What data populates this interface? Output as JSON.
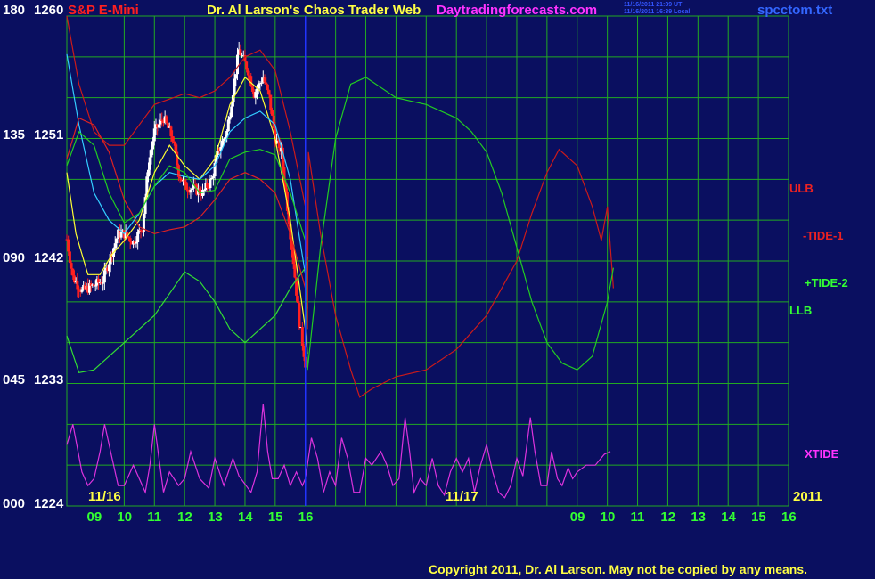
{
  "header": {
    "symbol": "S&P E-Mini",
    "title": "Dr. Al Larson's Chaos Trader Web",
    "site": "Daytradingforecasts.com",
    "time_ut": "11/16/2011 21:39 UT",
    "time_local": "11/16/2011 16:39 Local",
    "file": "spcctom.txt"
  },
  "copyright": "Copyright 2011, Dr. Al Larson. May not be copied by any means.",
  "colors": {
    "background": "#0a0f60",
    "grid": "#22aa22",
    "price_up": "#ffffff",
    "price_down": "#ff2020",
    "ulb": "#cc1a1a",
    "tide1": "#dd2222",
    "tide2": "#22cc22",
    "llb": "#33dd33",
    "xtide": "#dd33dd",
    "ma_fast": "#ffff33",
    "ma_slow": "#33ccff",
    "now_line": "#2233ff"
  },
  "chart_data": {
    "type": "line",
    "title": "Dr. Al Larson's Chaos Trader Web",
    "y_left_labels": [
      "180",
      "135",
      "090",
      "045",
      "000"
    ],
    "y_price_labels": [
      "1260",
      "1251",
      "1242",
      "1233",
      "1224"
    ],
    "ylim_price": [
      1224,
      1260
    ],
    "ylim_cycle": [
      0,
      180
    ],
    "x_ticks": [
      "09",
      "10",
      "11",
      "12",
      "13",
      "14",
      "15",
      "16",
      "09",
      "10",
      "11",
      "12",
      "13",
      "14",
      "15",
      "16"
    ],
    "date_labels": [
      "11/16",
      "11/17",
      "2011"
    ],
    "x_unit": "hour",
    "xlim_hours": [
      8.1,
      32.0
    ],
    "now_hour": 16.0,
    "grid": true,
    "series_labels": [
      "ULB",
      "-TIDE-1",
      "+TIDE-2",
      "LLB",
      "XTIDE"
    ],
    "price_knots": [
      [
        8.1,
        1243.6
      ],
      [
        8.3,
        1240.8
      ],
      [
        8.6,
        1239.8
      ],
      [
        9.0,
        1240.2
      ],
      [
        9.3,
        1240.6
      ],
      [
        9.5,
        1242.0
      ],
      [
        9.8,
        1244.0
      ],
      [
        10.0,
        1244.0
      ],
      [
        10.3,
        1243.4
      ],
      [
        10.6,
        1244.5
      ],
      [
        10.8,
        1249.0
      ],
      [
        11.0,
        1251.5
      ],
      [
        11.3,
        1252.5
      ],
      [
        11.6,
        1251.0
      ],
      [
        11.8,
        1248.5
      ],
      [
        12.0,
        1247.5
      ],
      [
        12.3,
        1247.3
      ],
      [
        12.6,
        1247.0
      ],
      [
        12.9,
        1248.0
      ],
      [
        13.1,
        1250.0
      ],
      [
        13.4,
        1251.5
      ],
      [
        13.6,
        1254.5
      ],
      [
        13.8,
        1257.5
      ],
      [
        14.1,
        1256.0
      ],
      [
        14.3,
        1254.3
      ],
      [
        14.6,
        1255.5
      ],
      [
        14.8,
        1254.0
      ],
      [
        15.0,
        1251.0
      ],
      [
        15.2,
        1250.0
      ],
      [
        15.4,
        1246.0
      ],
      [
        15.6,
        1242.0
      ],
      [
        15.8,
        1237.5
      ],
      [
        16.0,
        1234.5
      ],
      [
        16.05,
        1233.0
      ]
    ],
    "series": [
      {
        "id": "ma_fast",
        "knots": [
          [
            8.1,
            1248.5
          ],
          [
            8.4,
            1244.0
          ],
          [
            8.8,
            1241.0
          ],
          [
            9.2,
            1241.0
          ],
          [
            9.6,
            1242.5
          ],
          [
            10.0,
            1243.5
          ],
          [
            10.5,
            1245.0
          ],
          [
            11.0,
            1248.5
          ],
          [
            11.5,
            1250.5
          ],
          [
            12.0,
            1249.0
          ],
          [
            12.5,
            1248.0
          ],
          [
            13.0,
            1249.5
          ],
          [
            13.5,
            1253.5
          ],
          [
            14.0,
            1255.5
          ],
          [
            14.5,
            1254.5
          ],
          [
            15.0,
            1251.0
          ],
          [
            15.5,
            1245.0
          ],
          [
            16.0,
            1237.0
          ],
          [
            16.07,
            1235.2
          ]
        ]
      },
      {
        "id": "ma_slow",
        "knots": [
          [
            8.1,
            1257.2
          ],
          [
            8.5,
            1252.0
          ],
          [
            9.0,
            1247.0
          ],
          [
            9.5,
            1245.0
          ],
          [
            10.0,
            1244.0
          ],
          [
            10.5,
            1245.5
          ],
          [
            11.0,
            1247.5
          ],
          [
            11.5,
            1248.5
          ],
          [
            12.0,
            1248.2
          ],
          [
            12.5,
            1248.0
          ],
          [
            13.0,
            1249.0
          ],
          [
            13.5,
            1251.5
          ],
          [
            14.0,
            1252.5
          ],
          [
            14.5,
            1253.0
          ],
          [
            15.0,
            1252.0
          ],
          [
            15.5,
            1248.0
          ],
          [
            16.0,
            1241.0
          ],
          [
            16.07,
            1240.0
          ]
        ]
      },
      {
        "id": "ulb",
        "knots": [
          [
            8.1,
            1260.0
          ],
          [
            8.5,
            1255.0
          ],
          [
            9.0,
            1251.5
          ],
          [
            9.5,
            1250.5
          ],
          [
            10.0,
            1250.5
          ],
          [
            10.5,
            1252.0
          ],
          [
            11.0,
            1253.5
          ],
          [
            12.0,
            1254.3
          ],
          [
            12.5,
            1254.0
          ],
          [
            13.0,
            1254.5
          ],
          [
            13.5,
            1255.5
          ],
          [
            14.0,
            1257.0
          ],
          [
            14.5,
            1257.5
          ],
          [
            15.0,
            1256.0
          ],
          [
            15.5,
            1251.5
          ],
          [
            16.0,
            1246.0
          ],
          [
            16.07,
            1237.0
          ],
          [
            16.1,
            1250.0
          ],
          [
            16.5,
            1244.0
          ],
          [
            17.0,
            1238.0
          ],
          [
            17.5,
            1234.0
          ],
          [
            17.8,
            1232.0
          ],
          [
            18.2,
            1232.6
          ],
          [
            19.0,
            1233.5
          ],
          [
            20.0,
            1234.0
          ],
          [
            21.0,
            1235.5
          ],
          [
            22.0,
            1238.0
          ],
          [
            23.0,
            1242.0
          ],
          [
            23.5,
            1245.5
          ],
          [
            24.0,
            1248.5
          ],
          [
            24.4,
            1250.2
          ],
          [
            25.0,
            1249.0
          ],
          [
            25.5,
            1246.0
          ],
          [
            25.8,
            1243.5
          ],
          [
            26.0,
            1246.0
          ],
          [
            26.2,
            1240.0
          ]
        ]
      },
      {
        "id": "llb",
        "knots": [
          [
            8.1,
            1236.5
          ],
          [
            8.5,
            1233.8
          ],
          [
            9.0,
            1234.0
          ],
          [
            9.5,
            1235.0
          ],
          [
            10.0,
            1236.0
          ],
          [
            11.0,
            1238.0
          ],
          [
            12.0,
            1241.2
          ],
          [
            12.5,
            1240.5
          ],
          [
            13.0,
            1239.0
          ],
          [
            13.5,
            1237.0
          ],
          [
            14.0,
            1236.0
          ],
          [
            14.5,
            1237.0
          ],
          [
            15.0,
            1238.0
          ],
          [
            15.5,
            1240.0
          ],
          [
            16.0,
            1241.5
          ],
          [
            16.07,
            1242.3
          ]
        ]
      },
      {
        "id": "tide1",
        "knots": [
          [
            8.1,
            1249.5
          ],
          [
            8.5,
            1252.5
          ],
          [
            9.0,
            1252.0
          ],
          [
            9.5,
            1250.0
          ],
          [
            10.0,
            1246.5
          ],
          [
            10.5,
            1244.5
          ],
          [
            11.0,
            1244.0
          ],
          [
            11.5,
            1244.3
          ],
          [
            12.0,
            1244.5
          ],
          [
            12.5,
            1245.2
          ],
          [
            13.0,
            1246.5
          ],
          [
            13.5,
            1248.0
          ],
          [
            14.0,
            1248.5
          ],
          [
            14.5,
            1248.0
          ],
          [
            15.0,
            1247.0
          ],
          [
            15.5,
            1244.0
          ],
          [
            16.0,
            1240.0
          ],
          [
            16.07,
            1238.5
          ]
        ]
      },
      {
        "id": "tide2",
        "knots": [
          [
            8.1,
            1249.0
          ],
          [
            8.5,
            1251.5
          ],
          [
            9.0,
            1250.5
          ],
          [
            9.5,
            1247.0
          ],
          [
            10.0,
            1244.8
          ],
          [
            10.5,
            1245.5
          ],
          [
            11.0,
            1247.5
          ],
          [
            11.5,
            1249.0
          ],
          [
            12.0,
            1248.5
          ],
          [
            12.5,
            1247.0
          ],
          [
            13.0,
            1247.2
          ],
          [
            13.5,
            1249.5
          ],
          [
            14.0,
            1250.0
          ],
          [
            14.5,
            1250.2
          ],
          [
            15.0,
            1249.8
          ],
          [
            15.5,
            1247.0
          ],
          [
            16.0,
            1243.5
          ],
          [
            16.07,
            1234.0
          ],
          [
            16.5,
            1243.0
          ],
          [
            17.0,
            1251.0
          ],
          [
            17.5,
            1255.0
          ],
          [
            18.0,
            1255.5
          ],
          [
            19.0,
            1254.0
          ],
          [
            20.0,
            1253.5
          ],
          [
            21.0,
            1252.5
          ],
          [
            21.5,
            1251.5
          ],
          [
            22.0,
            1250.0
          ],
          [
            22.5,
            1247.0
          ],
          [
            23.0,
            1243.0
          ],
          [
            23.5,
            1239.0
          ],
          [
            24.0,
            1236.0
          ],
          [
            24.5,
            1234.5
          ],
          [
            25.0,
            1234.0
          ],
          [
            25.5,
            1235.0
          ],
          [
            26.0,
            1239.0
          ],
          [
            26.2,
            1241.5
          ]
        ]
      },
      {
        "id": "xtide",
        "knots": [
          [
            8.1,
            1228.5
          ],
          [
            8.3,
            1230.0
          ],
          [
            8.6,
            1226.5
          ],
          [
            8.8,
            1225.5
          ],
          [
            9.0,
            1226.0
          ],
          [
            9.2,
            1228.0
          ],
          [
            9.35,
            1230.0
          ],
          [
            9.6,
            1227.5
          ],
          [
            9.8,
            1225.5
          ],
          [
            10.0,
            1225.5
          ],
          [
            10.3,
            1227.0
          ],
          [
            10.5,
            1226.0
          ],
          [
            10.7,
            1225.0
          ],
          [
            10.85,
            1227.0
          ],
          [
            11.0,
            1230.0
          ],
          [
            11.15,
            1227.5
          ],
          [
            11.3,
            1225.0
          ],
          [
            11.5,
            1226.5
          ],
          [
            11.8,
            1225.5
          ],
          [
            12.0,
            1226.0
          ],
          [
            12.2,
            1228.0
          ],
          [
            12.5,
            1226.0
          ],
          [
            12.8,
            1225.3
          ],
          [
            13.0,
            1227.5
          ],
          [
            13.3,
            1225.5
          ],
          [
            13.6,
            1227.5
          ],
          [
            13.8,
            1226.2
          ],
          [
            14.2,
            1225.0
          ],
          [
            14.4,
            1226.5
          ],
          [
            14.6,
            1231.5
          ],
          [
            14.75,
            1228.0
          ],
          [
            14.9,
            1226.0
          ],
          [
            15.1,
            1226.0
          ],
          [
            15.3,
            1227.0
          ],
          [
            15.5,
            1225.5
          ],
          [
            15.7,
            1226.5
          ],
          [
            15.9,
            1225.5
          ],
          [
            16.0,
            1226.0
          ],
          [
            16.2,
            1229.0
          ],
          [
            16.4,
            1227.5
          ],
          [
            16.6,
            1225.0
          ],
          [
            16.8,
            1226.5
          ],
          [
            17.0,
            1225.5
          ],
          [
            17.2,
            1229.0
          ],
          [
            17.4,
            1227.5
          ],
          [
            17.6,
            1225.0
          ],
          [
            17.8,
            1225.0
          ],
          [
            18.0,
            1227.5
          ],
          [
            18.2,
            1227.0
          ],
          [
            18.5,
            1228.0
          ],
          [
            18.7,
            1227.0
          ],
          [
            18.9,
            1225.5
          ],
          [
            19.1,
            1226.0
          ],
          [
            19.3,
            1230.5
          ],
          [
            19.45,
            1228.0
          ],
          [
            19.6,
            1225.0
          ],
          [
            19.8,
            1226.0
          ],
          [
            20.0,
            1225.5
          ],
          [
            20.2,
            1227.5
          ],
          [
            20.4,
            1225.5
          ],
          [
            20.6,
            1224.8
          ],
          [
            20.8,
            1226.5
          ],
          [
            21.0,
            1227.5
          ],
          [
            21.2,
            1226.5
          ],
          [
            21.4,
            1227.5
          ],
          [
            21.6,
            1225.0
          ],
          [
            21.8,
            1227.0
          ],
          [
            22.0,
            1228.5
          ],
          [
            22.2,
            1226.5
          ],
          [
            22.4,
            1225.0
          ],
          [
            22.6,
            1224.6
          ],
          [
            22.8,
            1225.5
          ],
          [
            23.0,
            1227.5
          ],
          [
            23.2,
            1226.2
          ],
          [
            23.45,
            1230.5
          ],
          [
            23.6,
            1228.0
          ],
          [
            23.8,
            1225.5
          ],
          [
            24.0,
            1225.5
          ],
          [
            24.15,
            1228.0
          ],
          [
            24.35,
            1226.0
          ],
          [
            24.5,
            1225.5
          ],
          [
            24.7,
            1226.8
          ],
          [
            24.85,
            1226.0
          ],
          [
            25.0,
            1226.5
          ],
          [
            25.3,
            1227.0
          ],
          [
            25.6,
            1227.0
          ],
          [
            25.9,
            1227.8
          ],
          [
            26.1,
            1228.0
          ]
        ]
      }
    ]
  }
}
